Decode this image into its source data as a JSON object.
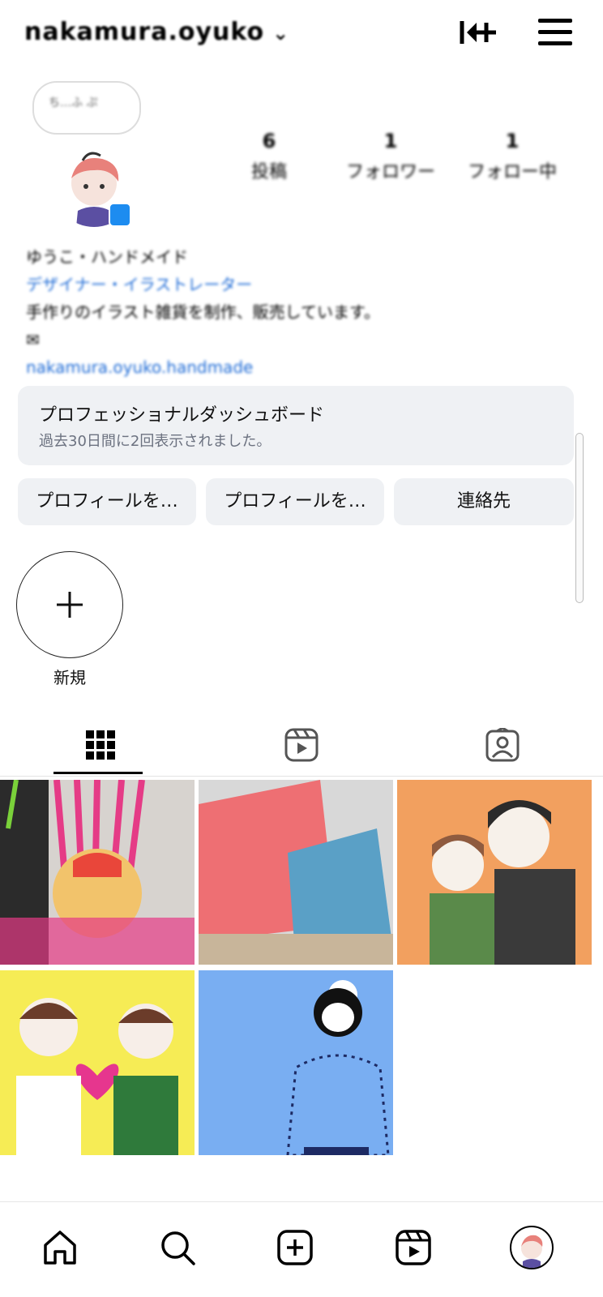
{
  "header": {
    "username": "nakamura.oyuko",
    "caret": "⌄",
    "icons": {
      "add_user": "add-user-icon",
      "menu": "hamburger-menu-icon"
    }
  },
  "profile": {
    "bubble_text": "ち…ふ ぷ",
    "verified_color": "#1d8cf0",
    "stats": [
      {
        "count": "6",
        "label": "投稿"
      },
      {
        "count": "1",
        "label": "フォロワー"
      },
      {
        "count": "1",
        "label": "フォロー中"
      }
    ],
    "bio": {
      "name_line": "ゆうこ・ハンドメイド",
      "category_line": "デザイナー・イラストレーター",
      "text_line1": "手作りのイラスト雑貨を制作、販売しています。",
      "text_line2": "✉",
      "link_line": "nakamura.oyuko.handmade"
    }
  },
  "dashboard": {
    "title": "プロフェッショナルダッシュボード",
    "subtitle": "過去30日間に2回表示されました。"
  },
  "buttons": {
    "edit_profile": "プロフィールを…",
    "share_profile": "プロフィールを…",
    "contact": "連絡先"
  },
  "highlight": {
    "new_label": "新規"
  },
  "tabs": [
    {
      "name": "grid-tab",
      "icon": "grid-icon",
      "active": true
    },
    {
      "name": "reels-tab",
      "icon": "reels-icon",
      "active": false
    },
    {
      "name": "tagged-tab",
      "icon": "tagged-user-icon",
      "active": false
    }
  ],
  "posts": [
    {
      "palette": [
        "#e53b86",
        "#f2c36b",
        "#cfd6d9",
        "#2b2b2b",
        "#e9463a"
      ]
    },
    {
      "palette": [
        "#ee6f73",
        "#5aa0c6",
        "#c8b59a",
        "#d8d8d8"
      ]
    },
    {
      "palette": [
        "#f2a05f",
        "#2b2b2b",
        "#f7f1ea",
        "#8f5b3f",
        "#5a8a4a"
      ]
    },
    {
      "palette": [
        "#f6ec55",
        "#e6368e",
        "#2f7a3b",
        "#ffffff",
        "#6b3c2a"
      ]
    },
    {
      "palette": [
        "#79aef2",
        "#111111",
        "#ffffff",
        "#1d2a63"
      ]
    }
  ],
  "bottom_nav": {
    "items": [
      "home-icon",
      "search-icon",
      "create-icon",
      "reels-icon",
      "profile-avatar"
    ]
  }
}
